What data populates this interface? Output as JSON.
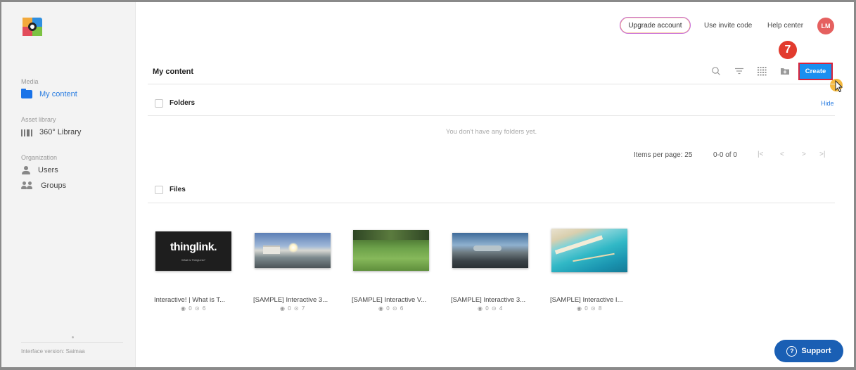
{
  "sidebar": {
    "sections": [
      {
        "title": "Media",
        "items": [
          {
            "label": "My content",
            "icon": "folder-icon",
            "active": true
          }
        ]
      },
      {
        "title": "Asset library",
        "items": [
          {
            "label": "360° Library",
            "icon": "library-icon"
          }
        ]
      },
      {
        "title": "Organization",
        "items": [
          {
            "label": "Users",
            "icon": "user-icon"
          },
          {
            "label": "Groups",
            "icon": "group-icon"
          }
        ]
      }
    ],
    "footer": "Interface version: Saimaa"
  },
  "topbar": {
    "upgrade_label": "Upgrade account",
    "invite_label": "Use invite code",
    "help_label": "Help center",
    "avatar_initials": "LM"
  },
  "content": {
    "title": "My content",
    "create_label": "Create",
    "step_number": "7",
    "folders": {
      "label": "Folders",
      "hide_label": "Hide",
      "empty_message": "You don't have any folders yet.",
      "items_per_page_label": "Items per page: 25",
      "range_label": "0-0 of 0"
    },
    "files": {
      "label": "Files",
      "items": [
        {
          "title": "Interactive! | What is T...",
          "views": "0",
          "tags": "6",
          "thumb_text": "thinglink.",
          "thumb_sub": "What is ThingLink?"
        },
        {
          "title": "[SAMPLE] Interactive 3...",
          "views": "0",
          "tags": "7"
        },
        {
          "title": "[SAMPLE] Interactive V...",
          "views": "0",
          "tags": "6"
        },
        {
          "title": "[SAMPLE] Interactive 3...",
          "views": "0",
          "tags": "4"
        },
        {
          "title": "[SAMPLE] Interactive I...",
          "views": "0",
          "tags": "8"
        }
      ]
    }
  },
  "support_label": "Support",
  "colors": {
    "accent": "#1a8ff0",
    "highlight": "#d8233a",
    "support": "#1a5fb4",
    "avatar": "#e5605f"
  }
}
